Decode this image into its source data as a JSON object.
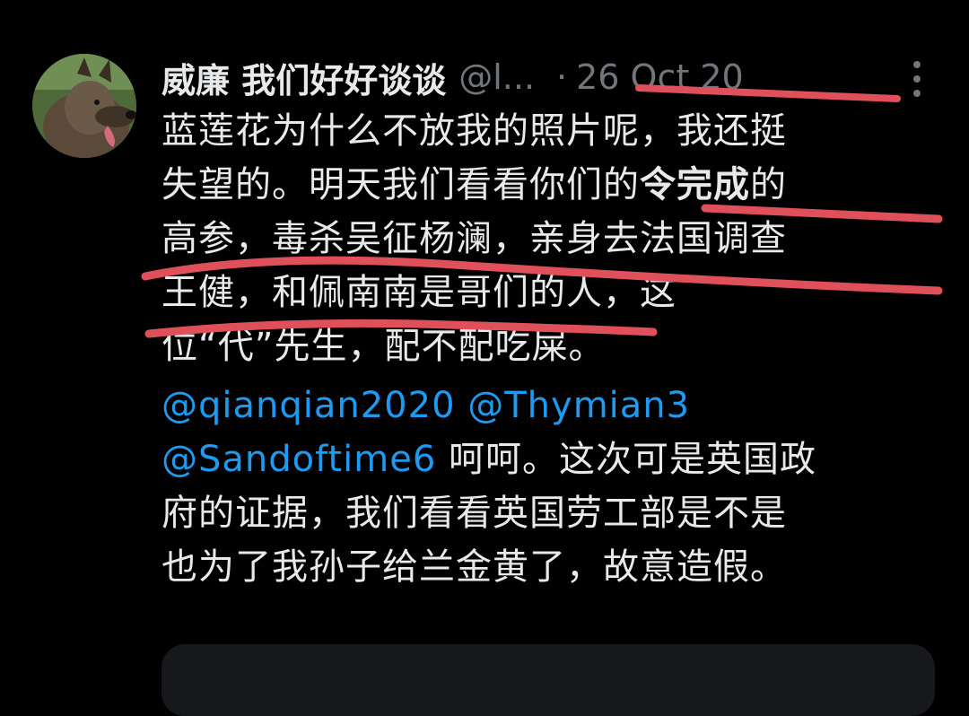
{
  "tweet": {
    "display_name": "威廉 我们好好谈谈",
    "handle": "@l...",
    "separator": "·",
    "date": "26 Oct 20",
    "more_icon": "more-vertical-icon",
    "avatar_icon": "dog-avatar",
    "lines": {
      "l1": "蓝莲花为什么不放我的照片呢，我还挺",
      "l2a": "失望的。明天我们看看你们的",
      "l2b": "令完成",
      "l2c": "的",
      "l3": "高参，毒杀吴征杨澜，亲身去法国调查",
      "l4": "王健，和佩南南是哥们的人，这",
      "l5": "位“代”先生，配不配吃屎。",
      "mention1": "@qianqian2020",
      "mention2": "@Thymian3",
      "mention3": "@Sandoftime6",
      "l7": " 呵呵。这次可是英国政",
      "l8": "府的证据，我们看看英国劳工部是不是",
      "l9": "也为了我孙子给兰金黄了，故意造假。"
    }
  },
  "colors": {
    "background": "#000000",
    "text": "#e7e9ea",
    "secondary": "#71767b",
    "mention": "#1d9bf0",
    "annotation": "#e0505a"
  }
}
